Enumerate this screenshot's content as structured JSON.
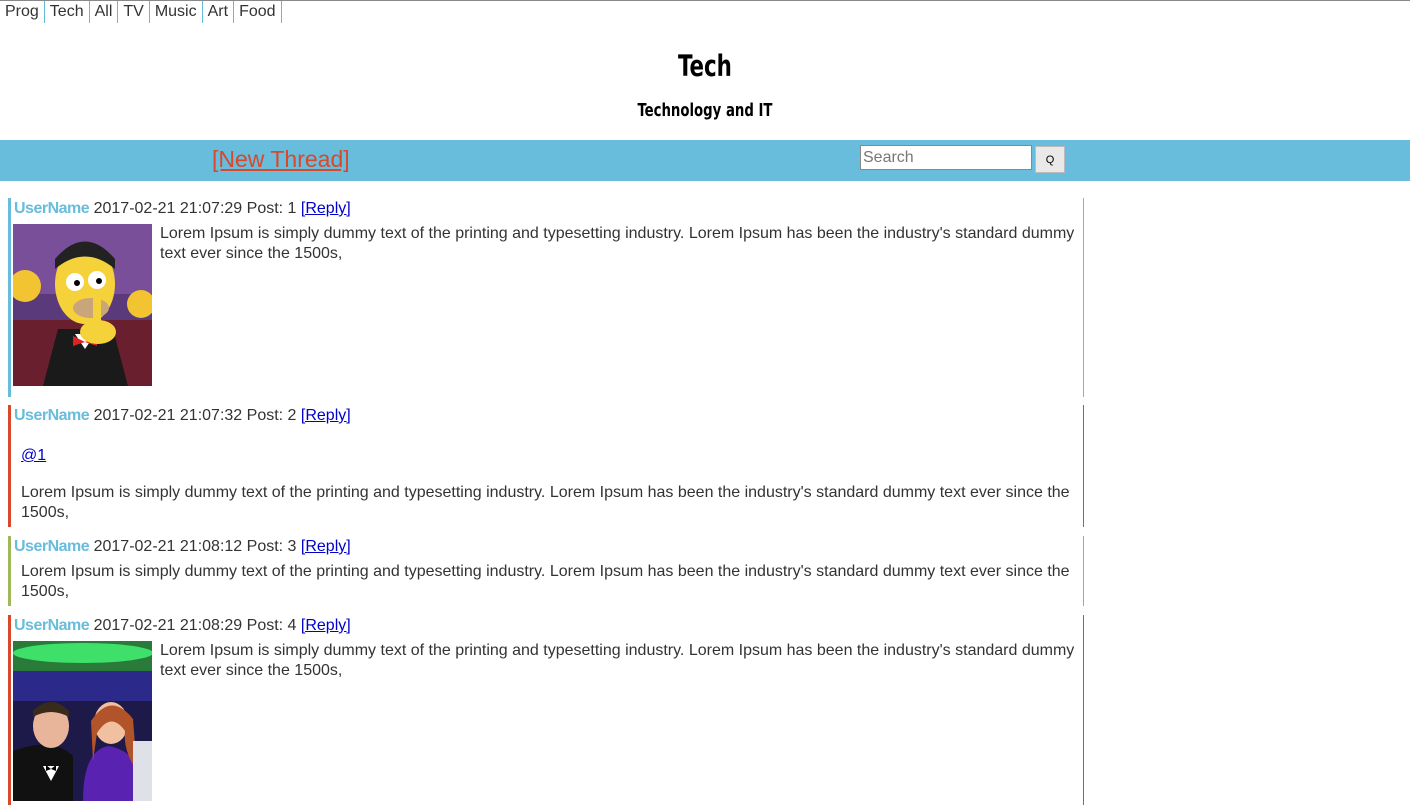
{
  "nav": {
    "items": [
      {
        "label": "Prog"
      },
      {
        "label": "Tech"
      },
      {
        "label": "All"
      },
      {
        "label": "TV"
      },
      {
        "label": "Music"
      },
      {
        "label": "Art"
      },
      {
        "label": "Food"
      }
    ]
  },
  "board": {
    "title": "Tech",
    "subtitle": "Technology and IT"
  },
  "toolbar": {
    "new_thread": "[New Thread]",
    "search_placeholder": "Search",
    "search_button": "Q"
  },
  "posts": [
    {
      "user": "UserName",
      "date": "2017-02-21 21:07:29",
      "post_label": "Post: 1",
      "reply": "[Reply]",
      "text": "Lorem Ipsum is simply dummy text of the printing and typesetting industry. Lorem Ipsum has been the industry's standard dummy text ever since the 1500s,",
      "image": "cartoon-character-thumbnail"
    },
    {
      "user": "UserName",
      "date": "2017-02-21 21:07:32",
      "post_label": "Post: 2",
      "reply": "[Reply]",
      "quote": "@1",
      "text": "Lorem Ipsum is simply dummy text of the printing and typesetting industry. Lorem Ipsum has been the industry's standard dummy text ever since the 1500s,"
    },
    {
      "user": "UserName",
      "date": "2017-02-21 21:08:12",
      "post_label": "Post: 3",
      "reply": "[Reply]",
      "text": "Lorem Ipsum is simply dummy text of the printing and typesetting industry. Lorem Ipsum has been the industry's standard dummy text ever since the 1500s,"
    },
    {
      "user": "UserName",
      "date": "2017-02-21 21:08:29",
      "post_label": "Post: 4",
      "reply": "[Reply]",
      "text": "Lorem Ipsum is simply dummy text of the printing and typesetting industry. Lorem Ipsum has been the industry's standard dummy text ever since the 1500s,",
      "image": "couple-photo-thumbnail"
    }
  ],
  "colors": {
    "accent": "#68bcdc",
    "red": "#d9482b",
    "green": "#9fb85a",
    "link": "#0000cc"
  }
}
